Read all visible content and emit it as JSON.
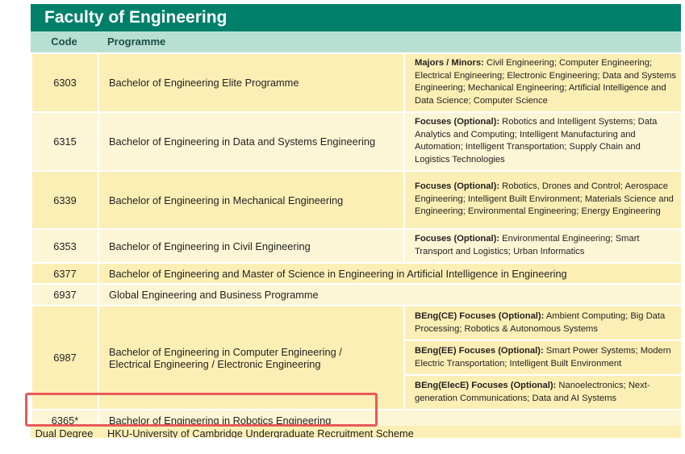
{
  "faculty_title": "Faculty of Engineering",
  "headers": {
    "code": "Code",
    "programme": "Programme"
  },
  "rows": {
    "r6303": {
      "code": "6303",
      "programme": "Bachelor of Engineering Elite Programme",
      "notes_label": "Majors / Minors:",
      "notes_text": " Civil Engineering; Computer Engineering; Electrical Engineering; Electronic Engineering; Data and Systems Engineering; Mechanical Engineering; Artificial Intelligence and Data Science; Computer Science"
    },
    "r6315": {
      "code": "6315",
      "programme": "Bachelor of Engineering in Data and Systems Engineering",
      "notes_label": "Focuses (Optional):",
      "notes_text": " Robotics and Intelligent Systems; Data Analytics and Computing; Intelligent Manufacturing and Automation; Intelligent Transportation; Supply Chain and Logistics Technologies"
    },
    "r6339": {
      "code": "6339",
      "programme": "Bachelor of Engineering in Mechanical Engineering",
      "notes_label": "Focuses (Optional):",
      "notes_text": " Robotics, Drones and Control; Aerospace Engineering; Intelligent Built Environment; Materials Science and Engineering; Environmental Engineering; Energy Engineering"
    },
    "r6353": {
      "code": "6353",
      "programme": "Bachelor of Engineering in Civil Engineering",
      "notes_label": "Focuses (Optional):",
      "notes_text": " Environmental Engineering; Smart Transport and Logistics; Urban Informatics"
    },
    "r6377": {
      "code": "6377",
      "programme": "Bachelor of Engineering and Master of Science in Engineering in Artificial Intelligence in Engineering"
    },
    "r6937": {
      "code": "6937",
      "programme": "Global Engineering and Business Programme"
    },
    "r6987": {
      "code": "6987",
      "programme_line1": "Bachelor of Engineering in Computer Engineering /",
      "programme_line2": "Electrical Engineering / Electronic Engineering",
      "ce_label": "BEng(CE) Focuses (Optional):",
      "ce_text": " Ambient Computing; Big Data Processing; Robotics & Autonomous Systems",
      "ee_label": "BEng(EE) Focuses (Optional):",
      "ee_text": " Smart Power Systems; Modern Electric Transportation; Intelligent Built Environment",
      "elece_label": "BEng(ElecE) Focuses (Optional):",
      "elece_text": " Nanoelectronics; Next-generation Communications; Data and AI Systems"
    },
    "r6365": {
      "code": "6365*",
      "programme": "Bachelor of Engineering in Robotics Engineering"
    },
    "dual": {
      "code": "Dual Degree",
      "programme": "HKU-University of Cambridge Undergraduate Recruitment Scheme"
    }
  }
}
